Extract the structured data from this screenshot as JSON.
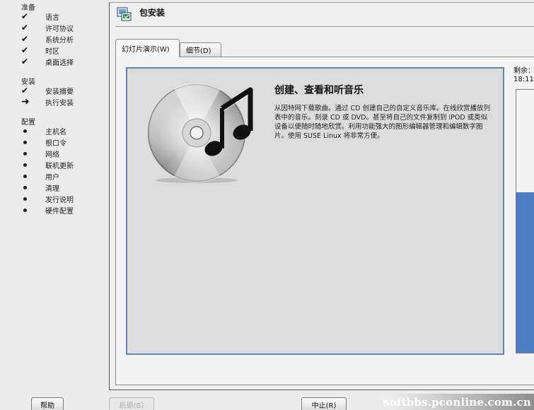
{
  "sidebar": {
    "sections": [
      {
        "title": "准备",
        "steps": [
          {
            "label": "语言",
            "state": "done"
          },
          {
            "label": "许可协议",
            "state": "done"
          },
          {
            "label": "系统分析",
            "state": "done"
          },
          {
            "label": "时区",
            "state": "done"
          },
          {
            "label": "桌面选择",
            "state": "done"
          }
        ]
      },
      {
        "title": "安装",
        "steps": [
          {
            "label": "安装摘要",
            "state": "done"
          },
          {
            "label": "执行安装",
            "state": "current"
          }
        ]
      },
      {
        "title": "配置",
        "steps": [
          {
            "label": "主机名",
            "state": "pending"
          },
          {
            "label": "根口令",
            "state": "pending"
          },
          {
            "label": "网络",
            "state": "pending"
          },
          {
            "label": "联机更新",
            "state": "pending"
          },
          {
            "label": "用户",
            "state": "pending"
          },
          {
            "label": "清理",
            "state": "pending"
          },
          {
            "label": "发行说明",
            "state": "pending"
          },
          {
            "label": "硬件配置",
            "state": "pending"
          }
        ]
      }
    ]
  },
  "header": {
    "title": "包安装",
    "icon": "package-install-icon"
  },
  "tabs": [
    {
      "label": "幻灯片演示(W)",
      "active": true
    },
    {
      "label": "细节(D)",
      "active": false
    }
  ],
  "slide": {
    "title": "创建、查看和听音乐",
    "body": "从因特网下载歌曲。通过 CD 创建自己的自定义音乐库。在线欣赏播放列表中的音乐。刻录 CD 或 DVD。甚至将自己的文件复制到 iPOD 或类似设备以便随时随地欣赏。利用功能强大的图形编辑器管理和编辑数字图片。使用 SUSE Linux 将非常方便。",
    "icon": "cd-music-icon"
  },
  "remaining": {
    "label": "剩余：",
    "time": "18:11"
  },
  "progress": {
    "fraction": 0.61,
    "color": "#4d7bc4"
  },
  "buttons": {
    "help": "帮助",
    "back": "后退(B)",
    "abort": "中止(R)"
  },
  "watermark": "softbbs.pconline.com.cn"
}
